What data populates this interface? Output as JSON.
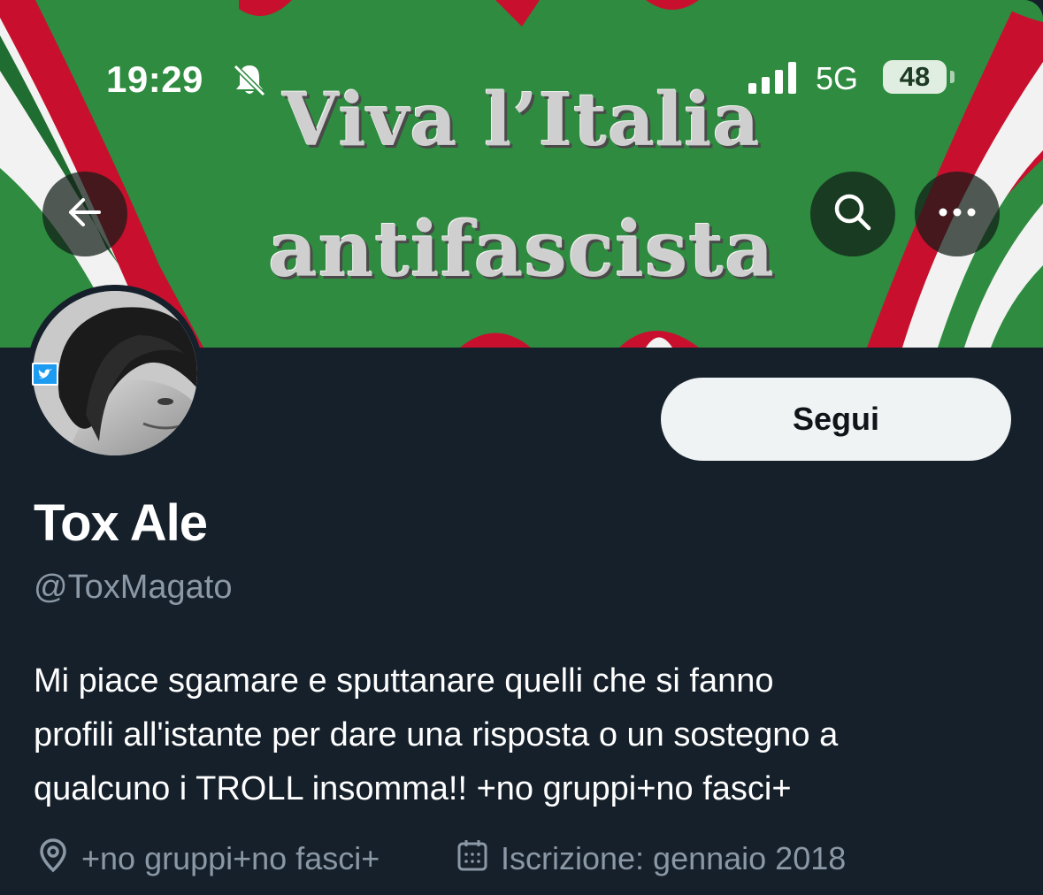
{
  "status_bar": {
    "time": "19:29",
    "network": "5G",
    "battery": "48",
    "icons": [
      "bell-muted-icon",
      "signal-icon",
      "battery-icon"
    ]
  },
  "banner": {
    "line1": "Viva l’Italia",
    "line2": "antifascista",
    "colors": {
      "green": "#2d8a3e",
      "white": "#f2f2f2",
      "red": "#c8102e"
    }
  },
  "header_buttons": {
    "back_icon": "arrow-left-icon",
    "search_icon": "search-icon",
    "more_icon": "more-icon"
  },
  "profile": {
    "display_name": "Tox Ale",
    "handle": "@ToxMagato",
    "follow_label": "Segui",
    "bio_lines": [
      "Mi piace sgamare e sputtanare quelli che si fanno",
      "profili all'istante per dare una risposta o un sostegno a",
      "qualcuno i TROLL insomma!! +no gruppi+no fasci+"
    ],
    "location": "+no gruppi+no fasci+",
    "joined": "Iscrizione: gennaio 2018"
  },
  "colors": {
    "background": "#15202b",
    "secondary_text": "#8b98a5",
    "follow_button": "#eff3f4",
    "badge_blue": "#1d9bf0"
  }
}
